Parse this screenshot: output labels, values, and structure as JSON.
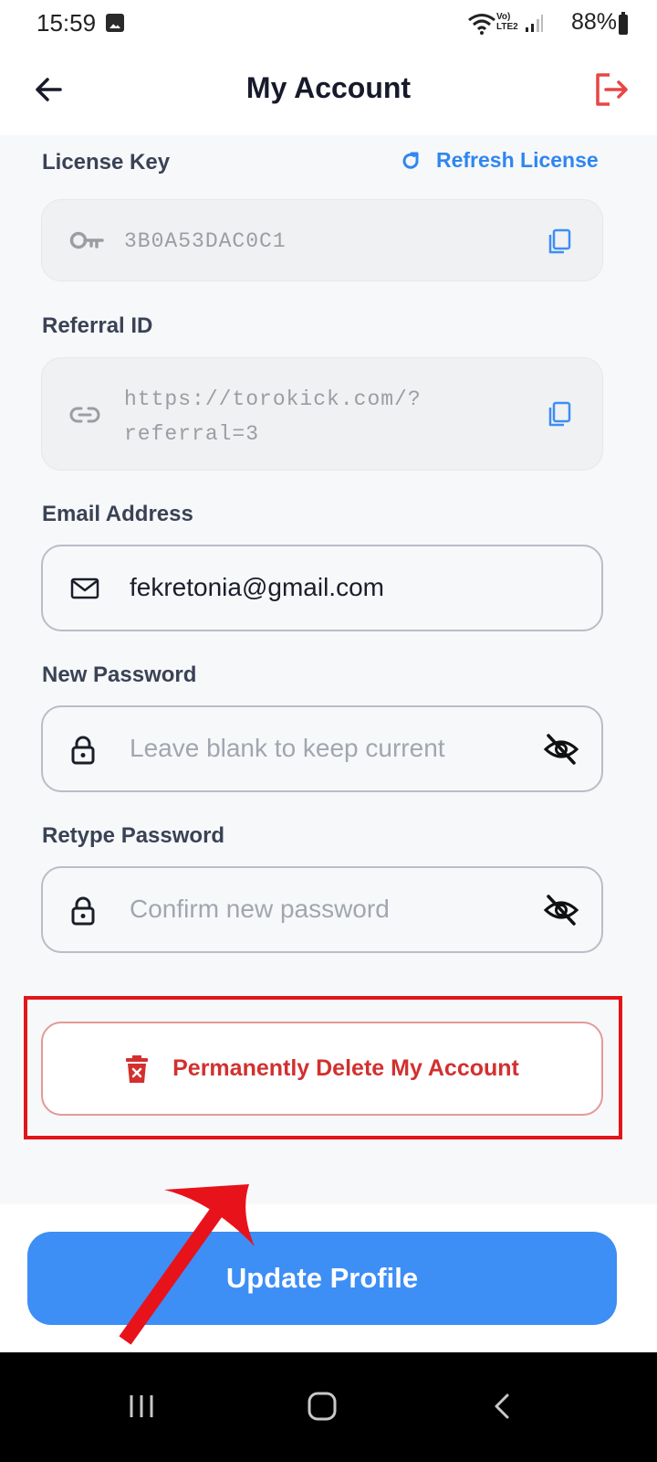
{
  "status": {
    "time": "15:59",
    "battery": "88%",
    "network": "LTE2"
  },
  "header": {
    "title": "My Account"
  },
  "license": {
    "label": "License Key",
    "refresh_label": "Refresh License",
    "value": "3B0A53DAC0C1"
  },
  "referral": {
    "label": "Referral ID",
    "line1": "https://torokick.com/?",
    "line2": "referral=3"
  },
  "email": {
    "label": "Email Address",
    "value": "fekretonia@gmail.com"
  },
  "new_password": {
    "label": "New Password",
    "placeholder": "Leave blank to keep current"
  },
  "retype_password": {
    "label": "Retype Password",
    "placeholder": "Confirm new password"
  },
  "delete": {
    "label": "Permanently Delete My Account"
  },
  "update": {
    "label": "Update Profile"
  },
  "colors": {
    "accent": "#3d8ef5",
    "danger": "#d2302f",
    "annotation": "#e3151a"
  }
}
